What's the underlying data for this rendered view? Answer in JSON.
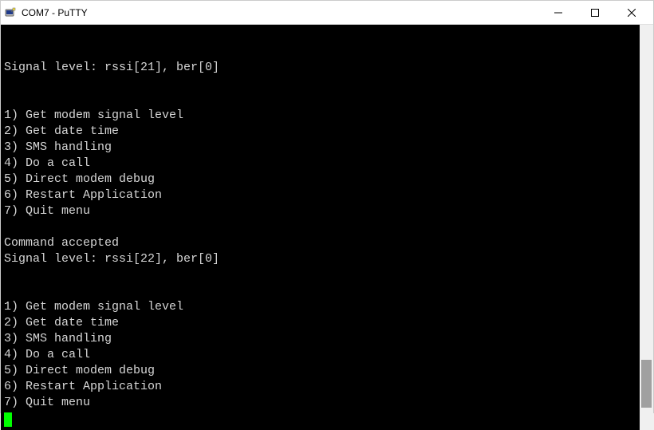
{
  "titlebar": {
    "title": "COM7 - PuTTY",
    "icon_name": "putty-icon"
  },
  "terminal": {
    "lines": [
      "Signal level: rssi[21], ber[0]",
      "",
      "",
      "1) Get modem signal level",
      "2) Get date time",
      "3) SMS handling",
      "4) Do a call",
      "5) Direct modem debug",
      "6) Restart Application",
      "7) Quit menu",
      "",
      "Command accepted",
      "Signal level: rssi[22], ber[0]",
      "",
      "",
      "1) Get modem signal level",
      "2) Get date time",
      "3) SMS handling",
      "4) Do a call",
      "5) Direct modem debug",
      "6) Restart Application",
      "7) Quit menu",
      ""
    ]
  }
}
